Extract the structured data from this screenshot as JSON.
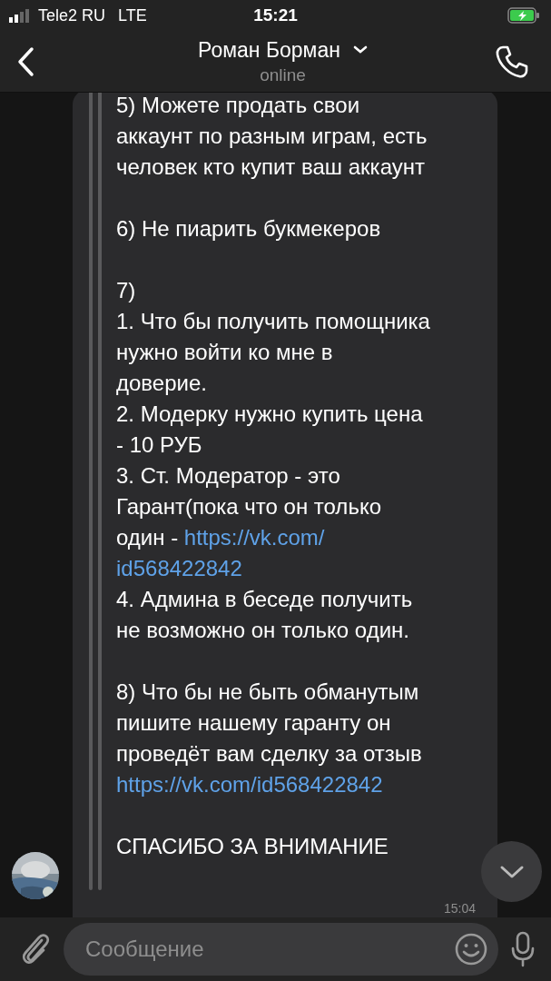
{
  "status_bar": {
    "carrier": "Tele2 RU",
    "network": "LTE",
    "time": "15:21"
  },
  "header": {
    "name": "Роман Борман",
    "status": "online"
  },
  "message": {
    "paragraphs": [
      {
        "lines": [
          {
            "text": "5) Можете продать свои"
          },
          {
            "text": "аккаунт по разным играм, есть"
          },
          {
            "text": "человек кто купит ваш аккаунт"
          }
        ]
      },
      {
        "lines": [
          {
            "text": "6) Не пиарить букмекеров"
          }
        ]
      },
      {
        "lines": [
          {
            "text": "7)"
          },
          {
            "text": "1. Что бы получить помощника"
          },
          {
            "text": "нужно войти ко мне в"
          },
          {
            "text": "доверие."
          },
          {
            "text": "2. Модерку нужно купить цена"
          },
          {
            "text": "- 10 РУБ"
          },
          {
            "text": "3. Ст. Модератор - это"
          },
          {
            "text": "Гарант(пока что он только"
          },
          {
            "text": "один - ",
            "link": "https://vk.com/"
          },
          {
            "link": "id568422842"
          },
          {
            "text": "4. Админа в беседе получить"
          },
          {
            "text": "не возможно он только один."
          }
        ]
      },
      {
        "lines": [
          {
            "text": "8) Что бы не быть обманутым"
          },
          {
            "text": "пишите нашему гаранту он"
          },
          {
            "text": "проведёт вам сделку за отзыв"
          },
          {
            "link": "https://vk.com/id568422842"
          }
        ]
      },
      {
        "lines": [
          {
            "text": "СПАСИБО ЗА ВНИМАНИЕ"
          }
        ]
      }
    ],
    "time": "15:04"
  },
  "composer": {
    "placeholder": "Сообщение"
  }
}
